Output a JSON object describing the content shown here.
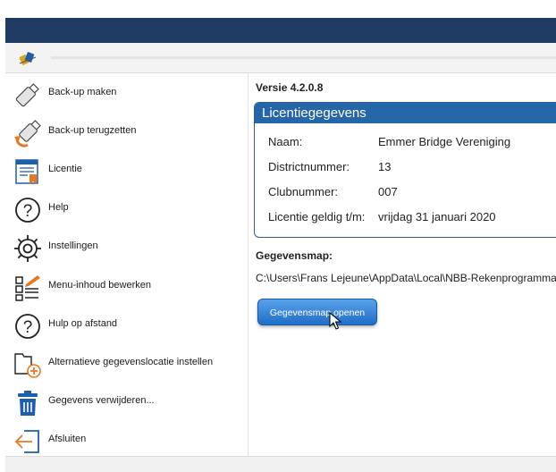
{
  "app": {
    "logo_icon": "bridge-cards-icon"
  },
  "sidebar": {
    "items": [
      {
        "label": "Back-up maken",
        "icon": "usb-drive-icon"
      },
      {
        "label": "Back-up terugzetten",
        "icon": "usb-drive-restore-icon"
      },
      {
        "label": "Licentie",
        "icon": "license-certificate-icon"
      },
      {
        "label": "Help",
        "icon": "help-icon"
      },
      {
        "label": "Instellingen",
        "icon": "gear-icon"
      },
      {
        "label": "Menu-inhoud bewerken",
        "icon": "edit-menu-icon"
      },
      {
        "label": "Hulp op afstand",
        "icon": "remote-help-icon"
      },
      {
        "label": "Alternatieve gegevenslocatie instellen",
        "icon": "folder-add-icon"
      },
      {
        "label": "Gegevens verwijderen...",
        "icon": "trash-icon"
      },
      {
        "label": "Afsluiten",
        "icon": "exit-icon"
      }
    ]
  },
  "main": {
    "version": "Versie 4.2.0.8",
    "license": {
      "title": "Licentiegegevens",
      "rows": [
        {
          "label": "Naam:",
          "value": "Emmer Bridge Vereniging"
        },
        {
          "label": "Districtnummer:",
          "value": "13"
        },
        {
          "label": "Clubnummer:",
          "value": "007"
        },
        {
          "label": "Licentie geldig t/m:",
          "value": "vrijdag 31 januari 2020"
        }
      ]
    },
    "data_folder": {
      "heading": "Gegevensmap:",
      "path": "C:\\Users\\Frans Lejeune\\AppData\\Local\\NBB-Rekenprogramma",
      "button_label": "Gegevensmap openen"
    }
  },
  "colors": {
    "titlebar": "#1f3a63",
    "accent": "#2466a7",
    "button": "#1f6ec7",
    "icon_blue": "#1d5fa8",
    "icon_orange": "#e87722"
  }
}
